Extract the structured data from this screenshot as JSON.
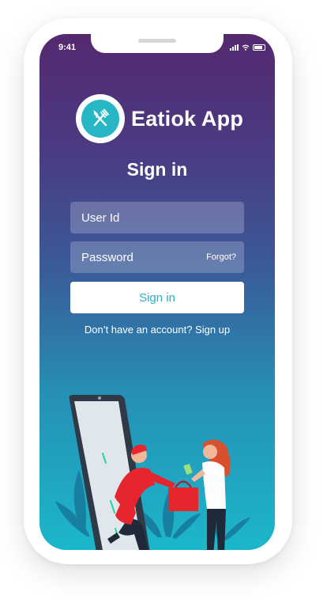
{
  "status_bar": {
    "time": "9:41"
  },
  "brand": {
    "app_name": "Eatiok App",
    "logo_icon": "fork-knife-icon",
    "accent": "#27b7c4"
  },
  "login": {
    "title": "Sign in",
    "user_id_placeholder": "User Id",
    "password_placeholder": "Password",
    "forgot_label": "Forgot?",
    "signin_button": "Sign in",
    "signup_prompt": "Don’t have an account? Sign up"
  },
  "colors": {
    "gradient_top": "#54296f",
    "gradient_bottom": "#1bb7cb",
    "button_text": "#2bb0c6"
  }
}
